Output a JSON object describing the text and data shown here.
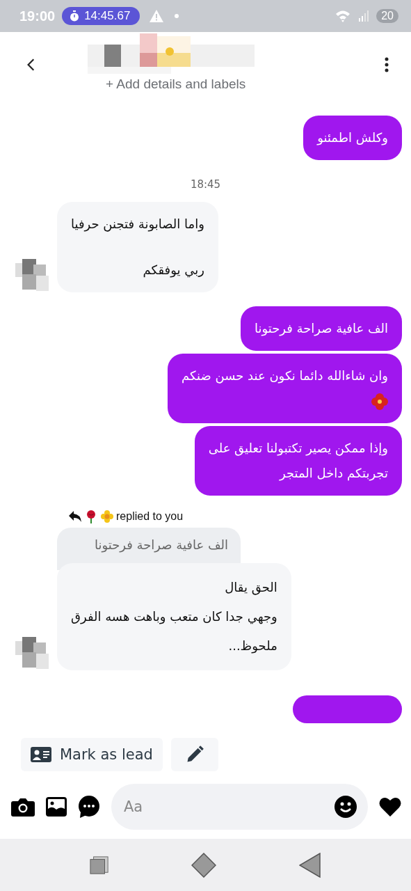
{
  "status_bar": {
    "time": "19:00",
    "timer": "14:45.67",
    "battery": "20"
  },
  "header": {
    "subtitle": "+ Add details and labels"
  },
  "messages": [
    {
      "kind": "sent",
      "lines": [
        "وكلش اطمئنو"
      ]
    },
    {
      "kind": "time",
      "text": "18:45"
    },
    {
      "kind": "received",
      "lines": [
        "واما الصابونة فتجنن حرفيا",
        "ربي يوفقكم"
      ],
      "avatar": true
    },
    {
      "kind": "sent",
      "lines": [
        "الف عافية صراحة فرحتونا"
      ]
    },
    {
      "kind": "sent",
      "lines": [
        "وان شاءالله دائما نكون عند حسن ضنكم"
      ],
      "flower": true
    },
    {
      "kind": "sent",
      "lines": [
        "وإذا ممكن يصير تكتبولنا تعليق على",
        "تجربتكم داخل المتجر"
      ]
    },
    {
      "kind": "reply",
      "label": "replied to you",
      "quote": "الف عافية صراحة فرحتونا",
      "lines": [
        "الحق يقال",
        "وجهي جدا كان متعب وباهت هسه الفرق",
        "ملحوظ..."
      ],
      "avatar": true
    },
    {
      "kind": "sent"
    }
  ],
  "actions": {
    "lead": "Mark as lead"
  },
  "composer": {
    "placeholder": "Aa"
  }
}
